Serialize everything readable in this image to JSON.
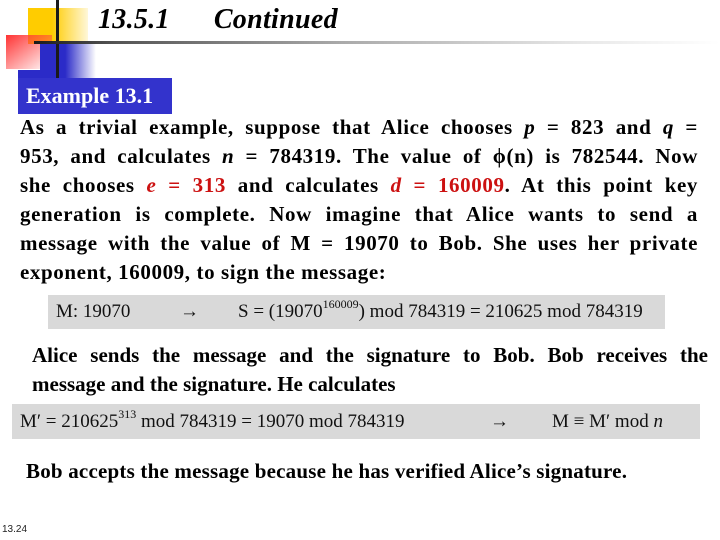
{
  "slide": {
    "section_number": "13.5.1",
    "title": "Continued",
    "page_number": "13.24"
  },
  "example": {
    "label": "Example 13.1"
  },
  "paragraph1": {
    "l1a": "As a trivial example, suppose that Alice chooses ",
    "l1_p_var": "p",
    "l1_p_val": " = 823 and ",
    "l1_q_var": "q",
    "l1_q_val": " =",
    "l2a": "953, and calculates ",
    "l2_n_var": "n",
    "l2_n_val": " = 784319. The value of ",
    "l2_phi": "ϕ",
    "l2b": "(n) is 782544. Now",
    "l3a": "she chooses ",
    "l3_e_var": "e",
    "l3_e_val": " = 313",
    "l3b": " and calculates ",
    "l3_d_var": "d",
    "l3_d_val": " = 160009",
    "l3c": ". At this point key",
    "l4": "generation is complete. Now imagine that Alice wants to send a",
    "l5": "message with the value of M = 19070 to Bob. She uses her private",
    "l6": "exponent, 160009, to sign the message:"
  },
  "formula1": {
    "message": "M: 19070",
    "arrow": "→",
    "sig_prefix": "S = (19070",
    "sig_exponent": "160009",
    "sig_suffix": ") mod 784319 = 210625 mod 784319"
  },
  "paragraph2": {
    "l1": "Alice sends the message and the signature to Bob. Bob receives the",
    "l2": "message and the signature. He calculates"
  },
  "formula2": {
    "lhs_prefix": "M′ = 210625",
    "lhs_exponent": "313",
    "lhs_suffix": " mod 784319 = 19070 mod 784319",
    "arrow": "→",
    "rhs_prefix": "M ≡ M′ mod ",
    "rhs_var": "n"
  },
  "conclusion": "Bob accepts the message because he has verified Alice’s signature.",
  "colors": {
    "example_label_bg": "#3333cc",
    "highlight_red": "#cc1111",
    "formula_bg": "#d9d9d9"
  }
}
